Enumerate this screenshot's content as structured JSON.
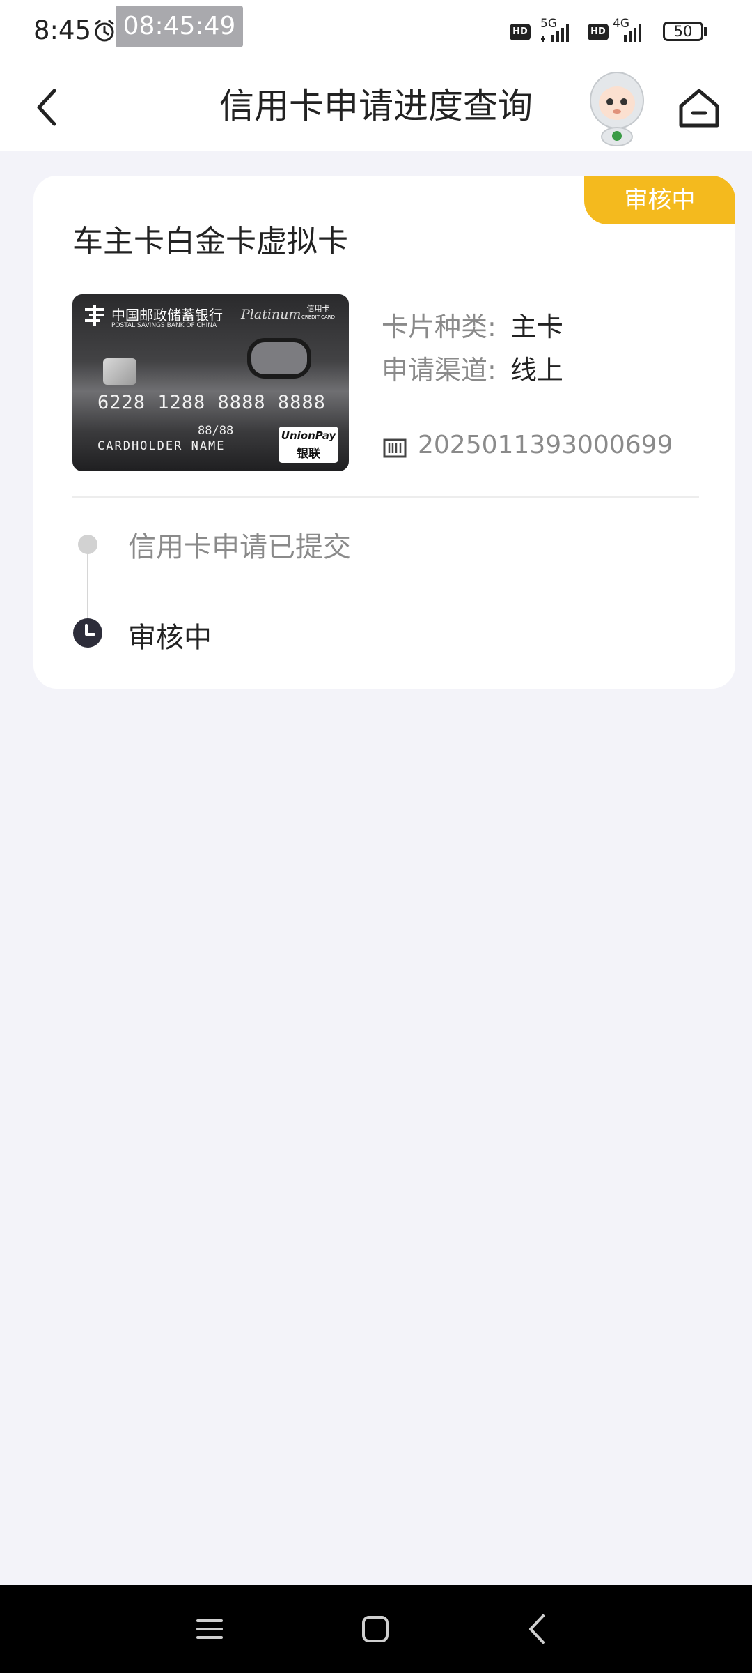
{
  "status_bar": {
    "time": "8:45",
    "clock_pill": "08:45:49",
    "network_1": "5G",
    "network_2": "4G",
    "hd_label": "HD",
    "battery": "50"
  },
  "header": {
    "title": "信用卡申请进度查询"
  },
  "application_card": {
    "status_badge": "审核中",
    "title": "车主卡白金卡虚拟卡",
    "card_face": {
      "bank_name": "中国邮政储蓄银行",
      "bank_name_en": "POSTAL SAVINGS BANK OF CHINA",
      "product_tier": "Platinum",
      "credit_card_label_cn": "信用卡",
      "credit_card_label_en": "CREDIT CARD",
      "card_number": "6228 1288 8888 8888",
      "valid_thru": "88/88",
      "holder_name": "CARDHOLDER NAME",
      "network_en": "UnionPay",
      "network_cn": "银联"
    },
    "card_type_label": "卡片种类:",
    "card_type_value": "主卡",
    "channel_label": "申请渠道:",
    "channel_value": "线上",
    "application_number": "2025011393000699",
    "timeline": [
      {
        "label": "信用卡申请已提交",
        "state": "done"
      },
      {
        "label": "审核中",
        "state": "current"
      }
    ]
  },
  "icons": {
    "back": "chevron-left-icon",
    "home": "home-icon",
    "barcode": "barcode-icon",
    "clock": "clock-icon",
    "mascot": "robot-mascot-icon"
  },
  "colors": {
    "badge": "#f4ba1e",
    "page_bg": "#f3f3f9"
  }
}
